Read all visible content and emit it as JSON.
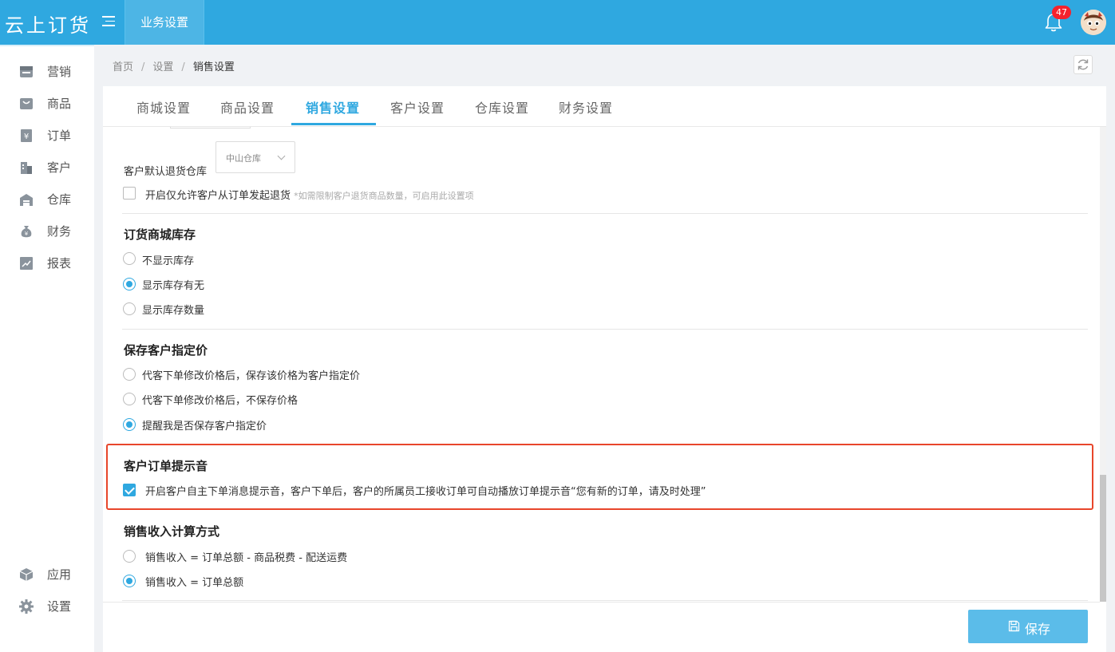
{
  "app": {
    "logo_text": "云上订货",
    "header_tab": "业务设置",
    "notification_count": "47"
  },
  "sidebar": {
    "items": [
      {
        "label": "营销",
        "icon": "storefront-icon"
      },
      {
        "label": "商品",
        "icon": "shopping-bag-icon"
      },
      {
        "label": "订单",
        "icon": "order-receipt-icon"
      },
      {
        "label": "客户",
        "icon": "building-icon"
      },
      {
        "label": "仓库",
        "icon": "warehouse-icon"
      },
      {
        "label": "财务",
        "icon": "money-bag-icon"
      },
      {
        "label": "报表",
        "icon": "chart-icon"
      }
    ],
    "bottom_items": [
      {
        "label": "应用",
        "icon": "cube-icon"
      },
      {
        "label": "设置",
        "icon": "gear-icon"
      }
    ]
  },
  "breadcrumb": {
    "home": "首页",
    "settings": "设置",
    "current": "销售设置",
    "separator": "/"
  },
  "tabs": [
    "商城设置",
    "商品设置",
    "销售设置",
    "客户设置",
    "仓库设置",
    "财务设置"
  ],
  "active_tab": "销售设置",
  "return_warehouse": {
    "label": "客户默认退货仓库",
    "selected": "中山仓库",
    "only_from_order_label": "开启仅允许客户从订单发起退货",
    "only_from_order_hint": "*如需限制客户退货商品数量，可启用此设置项",
    "only_from_order_checked": false
  },
  "mall_stock": {
    "title": "订货商城库存",
    "options": [
      "不显示库存",
      "显示库存有无",
      "显示库存数量"
    ],
    "selected_index": 1
  },
  "customer_price": {
    "title": "保存客户指定价",
    "options": [
      "代客下单修改价格后，保存该价格为客户指定价",
      "代客下单修改价格后，不保存价格",
      "提醒我是否保存客户指定价"
    ],
    "selected_index": 2
  },
  "order_sound": {
    "title": "客户订单提示音",
    "label": "开启客户自主下单消息提示音，客户下单后，客户的所属员工接收订单可自动播放订单提示音“您有新的订单，请及时处理”",
    "checked": true
  },
  "income_calc": {
    "title": "销售收入计算方式",
    "options": [
      "销售收入 = 订单总额 - 商品税费 - 配送运费",
      "销售收入 = 订单总额"
    ],
    "selected_index": 1
  },
  "save_button": "保存",
  "colors": {
    "brand": "#2fa8e0",
    "highlight_border": "#e8462b",
    "badge": "#f5222d"
  }
}
